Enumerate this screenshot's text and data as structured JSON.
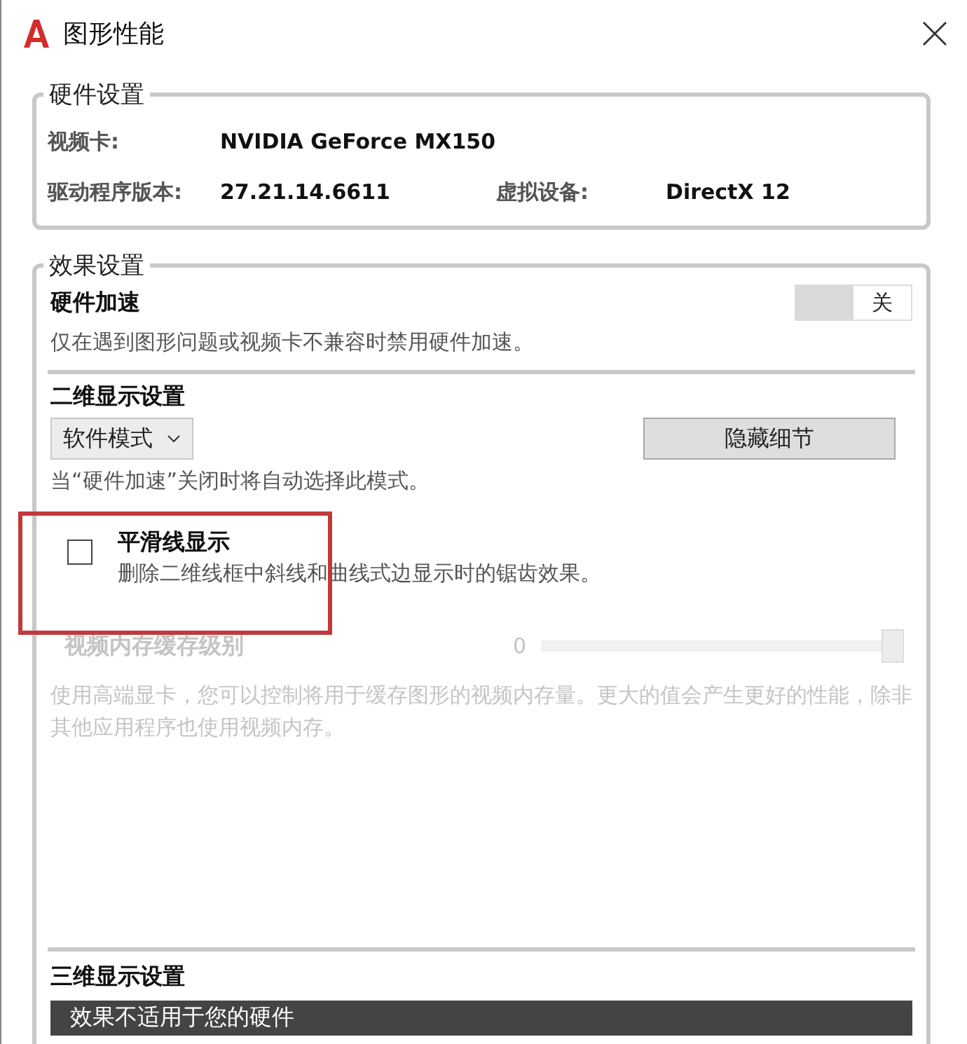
{
  "window": {
    "title": "图形性能"
  },
  "hardware": {
    "legend": "硬件设置",
    "video_card": {
      "label": "视频卡:",
      "value": "NVIDIA GeForce MX150"
    },
    "driver": {
      "label": "驱动程序版本:",
      "value": "27.21.14.6611"
    },
    "virtual_device": {
      "label": "虚拟设备:",
      "value": "DirectX 12"
    }
  },
  "effects": {
    "legend": "效果设置",
    "hardware_acceleration": {
      "title": "硬件加速",
      "description": "仅在遇到图形问题或视频卡不兼容时禁用硬件加速。",
      "toggle": {
        "label": "关",
        "on": false
      }
    },
    "display_2d": {
      "title": "二维显示设置",
      "mode": {
        "value": "软件模式"
      },
      "details_button": "隐藏细节",
      "note": "当“硬件加速”关闭时将自动选择此模式。",
      "smooth_lines": {
        "title": "平滑线显示",
        "description": "删除二维线框中斜线和曲线式边显示时的锯齿效果。",
        "checked": false
      },
      "vram_cache": {
        "title": "视频内存缓存级别",
        "reading": "0",
        "level": 1,
        "disabled": true,
        "description": "使用高端显卡，您可以控制将用于缓存图形的视频内存量。更大的值会产生更好的性能，除非其他应用程序也使用视频内存。"
      }
    },
    "display_3d": {
      "title": "三维显示设置",
      "banner": "效果不适用于您的硬件"
    }
  }
}
